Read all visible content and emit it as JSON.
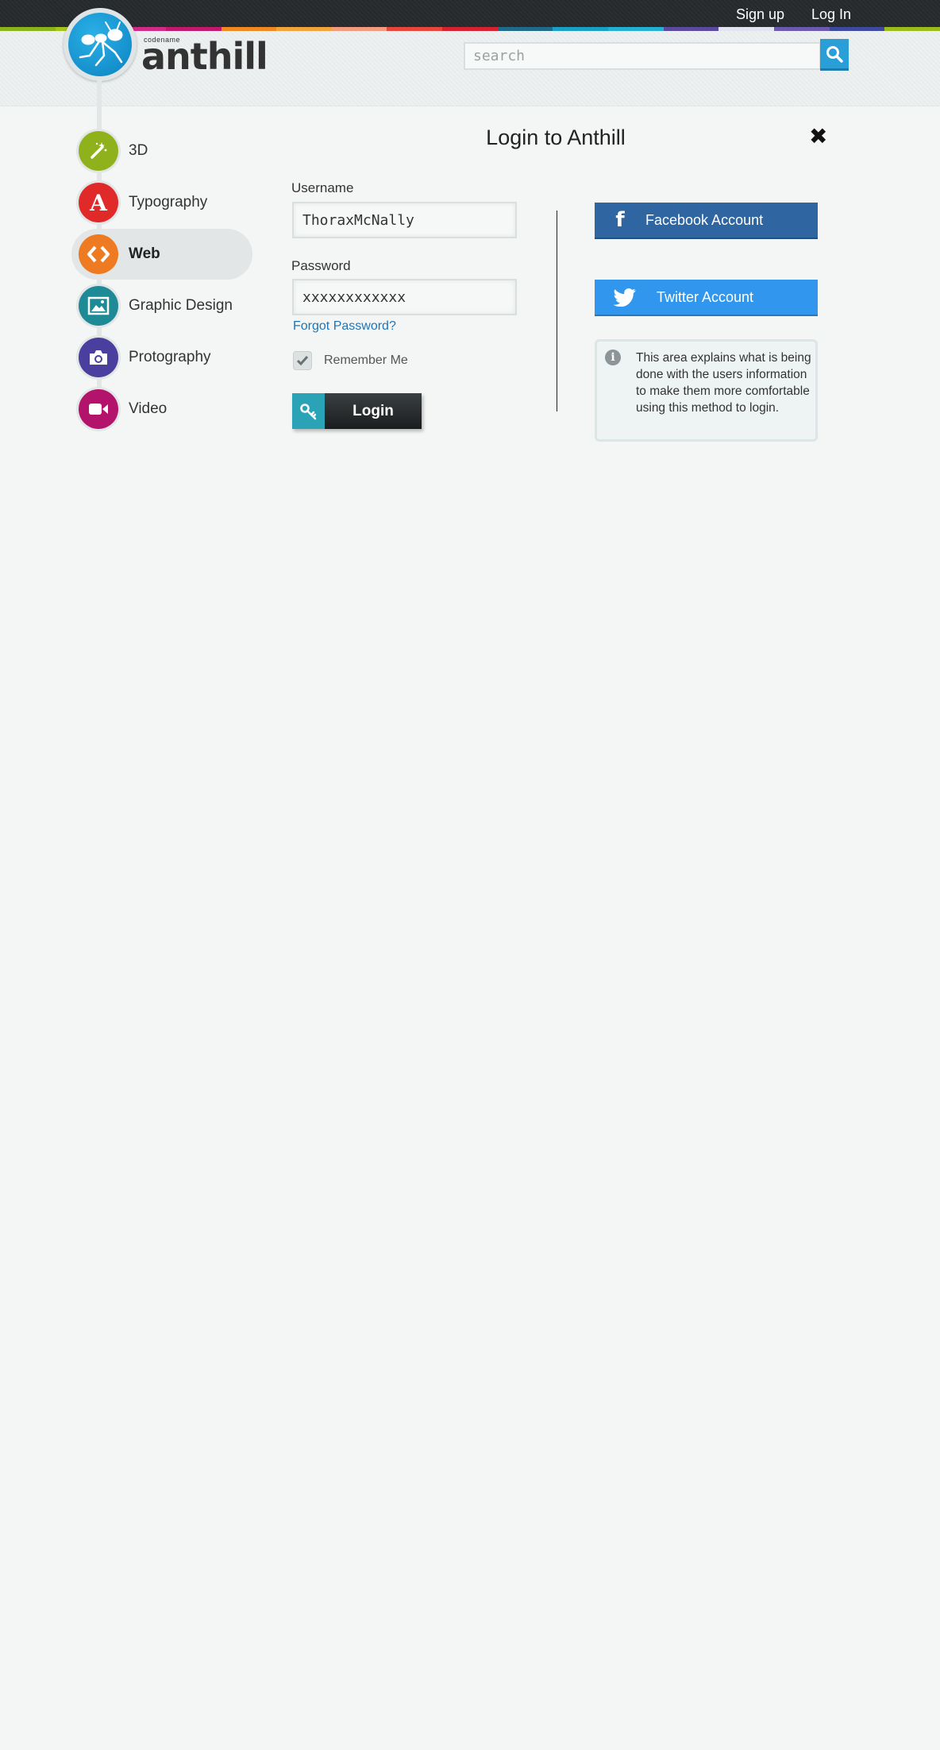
{
  "top_nav": {
    "signup": "Sign up",
    "login": "Log In"
  },
  "stripe_colors": [
    "#8ab31c",
    "#a4c41a",
    "#d12a8a",
    "#c2186d",
    "#ef8a23",
    "#f2a33a",
    "#f39a7f",
    "#e8453b",
    "#d92231",
    "#1f6b8a",
    "#1aa0c6",
    "#22b0d4",
    "#5b4aa0",
    "#e3e4f0",
    "#6c5ab0",
    "#3d4aa0",
    "#9bbc1c"
  ],
  "logo": {
    "codename": "codename",
    "word": "anthill"
  },
  "search": {
    "placeholder": "search"
  },
  "sidebar": {
    "items": [
      {
        "label": "3D",
        "icon": "magic-wand-icon",
        "color": "#8fb21c"
      },
      {
        "label": "Typography",
        "icon": "letter-a-icon",
        "color": "#e02a2a"
      },
      {
        "label": "Web",
        "icon": "code-brackets-icon",
        "color": "#ee7a22",
        "active": true
      },
      {
        "label": "Graphic Design",
        "icon": "image-icon",
        "color": "#1e8a96"
      },
      {
        "label": "Protography",
        "icon": "camera-icon",
        "color": "#4a3f9e"
      },
      {
        "label": "Video",
        "icon": "video-camera-icon",
        "color": "#b3136a"
      }
    ]
  },
  "login": {
    "title": "Login to Anthill",
    "close_icon": "close-icon",
    "username_label": "Username",
    "username_value": "ThoraxMcNally",
    "password_label": "Password",
    "password_value": "xxxxxxxxxxxx",
    "forgot": "Forgot Password?",
    "remember": "Remember Me",
    "remember_checked": true,
    "button": "Login"
  },
  "social": {
    "facebook": "Facebook Account",
    "twitter": "Twitter Account",
    "info": "This area explains what is being done with the users information to make them more comfortable using this method to login."
  }
}
